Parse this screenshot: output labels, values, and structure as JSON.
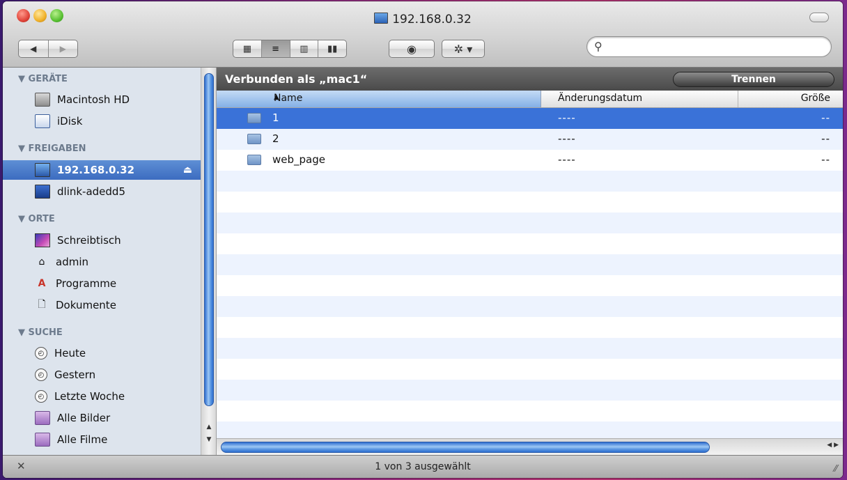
{
  "window": {
    "title": "192.168.0.32"
  },
  "toolbar": {
    "back_icon": "◀",
    "forward_icon": "▶",
    "views": [
      {
        "icon": "▦",
        "name": "icon-view"
      },
      {
        "icon": "≡",
        "name": "list-view"
      },
      {
        "icon": "▥",
        "name": "column-view"
      },
      {
        "icon": "▮▮",
        "name": "coverflow-view"
      }
    ],
    "eye_icon": "◉",
    "gear_icon": "✲ ▾",
    "search": {
      "value": "",
      "placeholder": ""
    }
  },
  "sidebar": {
    "sections": [
      {
        "title": "▼ GERÄTE"
      },
      {
        "title": "▼ FREIGABEN"
      },
      {
        "title": "▼ ORTE"
      },
      {
        "title": "▼ SUCHE"
      }
    ],
    "items": [
      {
        "label": "Macintosh HD"
      },
      {
        "label": "iDisk"
      },
      {
        "label": "192.168.0.32"
      },
      {
        "label": "dlink-adedd5"
      },
      {
        "label": "Schreibtisch"
      },
      {
        "label": "admin"
      },
      {
        "label": "Programme"
      },
      {
        "label": "Dokumente"
      },
      {
        "label": "Heute"
      },
      {
        "label": "Gestern"
      },
      {
        "label": "Letzte Woche"
      },
      {
        "label": "Alle Bilder"
      },
      {
        "label": "Alle Filme"
      }
    ],
    "eject_icon": "⏏"
  },
  "connection": {
    "text": "Verbunden als „mac1“",
    "disconnect_label": "Trennen"
  },
  "columns": {
    "name": "Name",
    "date": "Änderungsdatum",
    "size": "Größe",
    "sort_icon": "▲"
  },
  "files": [
    {
      "name": "1",
      "date": "----",
      "size": "--"
    },
    {
      "name": "2",
      "date": "----",
      "size": "--"
    },
    {
      "name": "web_page",
      "date": "----",
      "size": "--"
    }
  ],
  "status": {
    "text": "1 von 3 ausgewählt"
  },
  "colors": {
    "selection": "#3a72d8",
    "sidebar_bg": "#dde4ed",
    "scroll_thumb": "#5a97e2"
  }
}
